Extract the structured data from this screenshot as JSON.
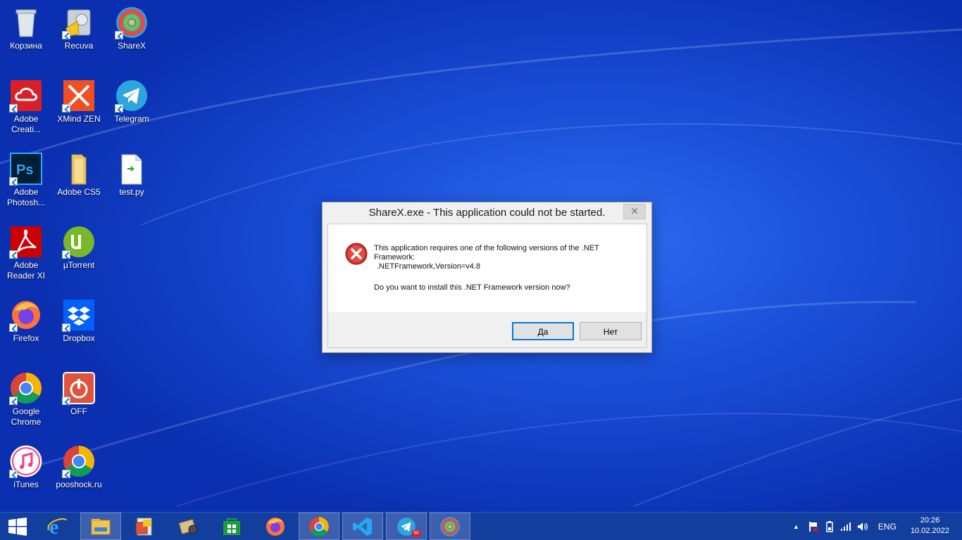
{
  "desktop": {
    "icons": [
      {
        "label": "Корзина"
      },
      {
        "label": "Recuva"
      },
      {
        "label": "ShareX"
      },
      {
        "label": "Adobe Creati..."
      },
      {
        "label": "XMind ZEN"
      },
      {
        "label": "Telegram"
      },
      {
        "label": "Adobe Photosh..."
      },
      {
        "label": "Adobe CS5"
      },
      {
        "label": "test.py"
      },
      {
        "label": "Adobe Reader XI"
      },
      {
        "label": "µTorrent"
      },
      {
        "label": "Firefox"
      },
      {
        "label": "Dropbox"
      },
      {
        "label": "Google Chrome"
      },
      {
        "label": "OFF"
      },
      {
        "label": "iTunes"
      },
      {
        "label": "pooshock.ru"
      }
    ]
  },
  "dialog": {
    "title": "ShareX.exe - This application could not be started.",
    "close_glyph": "✕",
    "message_line1": "This application requires one of the following versions of the .NET Framework:",
    "message_version": ".NETFramework,Version=v4.8",
    "question": "Do you want to install this .NET Framework version now?",
    "yes_label": "Да",
    "no_label": "Нет"
  },
  "taskbar": {
    "telegram_badge": "50",
    "language": "ENG",
    "time": "20:26",
    "date": "10.02.2022"
  },
  "colors": {
    "accent": "#0078d7",
    "taskbar": "#123e9e",
    "error_red": "#d32f2f"
  }
}
